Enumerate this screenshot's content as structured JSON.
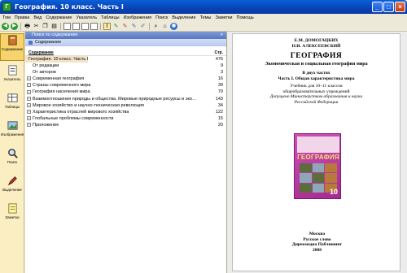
{
  "window": {
    "title": "География. 10 класс. Часть I",
    "app_icon_letter": "Г"
  },
  "menu": [
    "Том",
    "Правка",
    "Вид",
    "Содержание",
    "Указатель",
    "Таблицы",
    "Изображения",
    "Поиск",
    "Выделение",
    "Темы",
    "Заметки",
    "Помощь"
  ],
  "toolbar_icons": [
    "back-icon",
    "forward-icon",
    "print-icon",
    "cut-icon",
    "copy-icon",
    "paste-icon",
    "page-view-icon",
    "split-view-icon",
    "text-view-icon",
    "layout-icon",
    "text-cursor-icon",
    "pencil-green-icon",
    "pencil-red-icon",
    "marker-icon",
    "annotation-icon",
    "search-icon",
    "home-icon",
    "globe-icon"
  ],
  "sidebar": [
    {
      "label": "Содержание",
      "icon": "book-icon",
      "active": true
    },
    {
      "label": "Указатель",
      "icon": "index-icon",
      "active": false
    },
    {
      "label": "Таблицы",
      "icon": "table-icon",
      "active": false
    },
    {
      "label": "Изображения",
      "icon": "image-icon",
      "active": false
    },
    {
      "label": "Поиск",
      "icon": "search-icon",
      "active": false
    },
    {
      "label": "Выделение",
      "icon": "highlight-icon",
      "active": false
    },
    {
      "label": "Заметки",
      "icon": "notes-icon",
      "active": false
    }
  ],
  "toc": {
    "header": "Поиск по содержанию",
    "tab": "Содержание",
    "col_content": "Содержание",
    "col_page": "Стр.",
    "rows": [
      {
        "title": "География. 10 класс. Часть I",
        "page": "476",
        "expand": false,
        "indent": 0,
        "selected": true
      },
      {
        "title": "От редакции",
        "page": "9",
        "expand": false,
        "indent": 1
      },
      {
        "title": "От авторов",
        "page": "3",
        "expand": false,
        "indent": 1
      },
      {
        "title": "Современная география",
        "page": "16",
        "expand": true,
        "indent": 1
      },
      {
        "title": "Страны современного мира",
        "page": "39",
        "expand": true,
        "indent": 1
      },
      {
        "title": "География населения мира",
        "page": "79",
        "expand": true,
        "indent": 1
      },
      {
        "title": "Взаимоотношения природы и общества. Мировые природные ресурсы и экологи...",
        "page": "143",
        "expand": true,
        "indent": 1
      },
      {
        "title": "Мировое хозяйство и научно-техническая революция",
        "page": "34",
        "expand": true,
        "indent": 1
      },
      {
        "title": "Характеристика отраслей мирового хозяйства",
        "page": "122",
        "expand": true,
        "indent": 1
      },
      {
        "title": "Глобальные проблемы современности",
        "page": "15",
        "expand": true,
        "indent": 1
      },
      {
        "title": "Приложение",
        "page": "20",
        "expand": true,
        "indent": 1
      }
    ]
  },
  "page": {
    "author1": "Е.М. ДОМОГАЦКИХ",
    "author2": "Н.И. АЛЕКСЕЕВСКИЙ",
    "title": "ГЕОГРАФИЯ",
    "subtitle": "Экономическая и социальная география мира",
    "parts": "В двух частях",
    "part1": "Часть I. Общая характеристика мира",
    "textbook1": "Учебник для 10–11 классов",
    "textbook2": "общеобразовательных учреждений",
    "approved1": "Допущено Министерством образования и науки",
    "approved2": "Российской Федерации",
    "cover_title": "ГЕОГРАФИЯ",
    "cover_grade": "10",
    "city": "Москва",
    "publisher1": "Русское слово",
    "publisher2": "Дирекмедиа Паблишинг",
    "year": "2008"
  },
  "colors": {
    "titlebar": "#0843b5",
    "sidebar_bg": "#fbeec3",
    "toc_header": "#5677c2",
    "cover": "#b83a9e"
  }
}
